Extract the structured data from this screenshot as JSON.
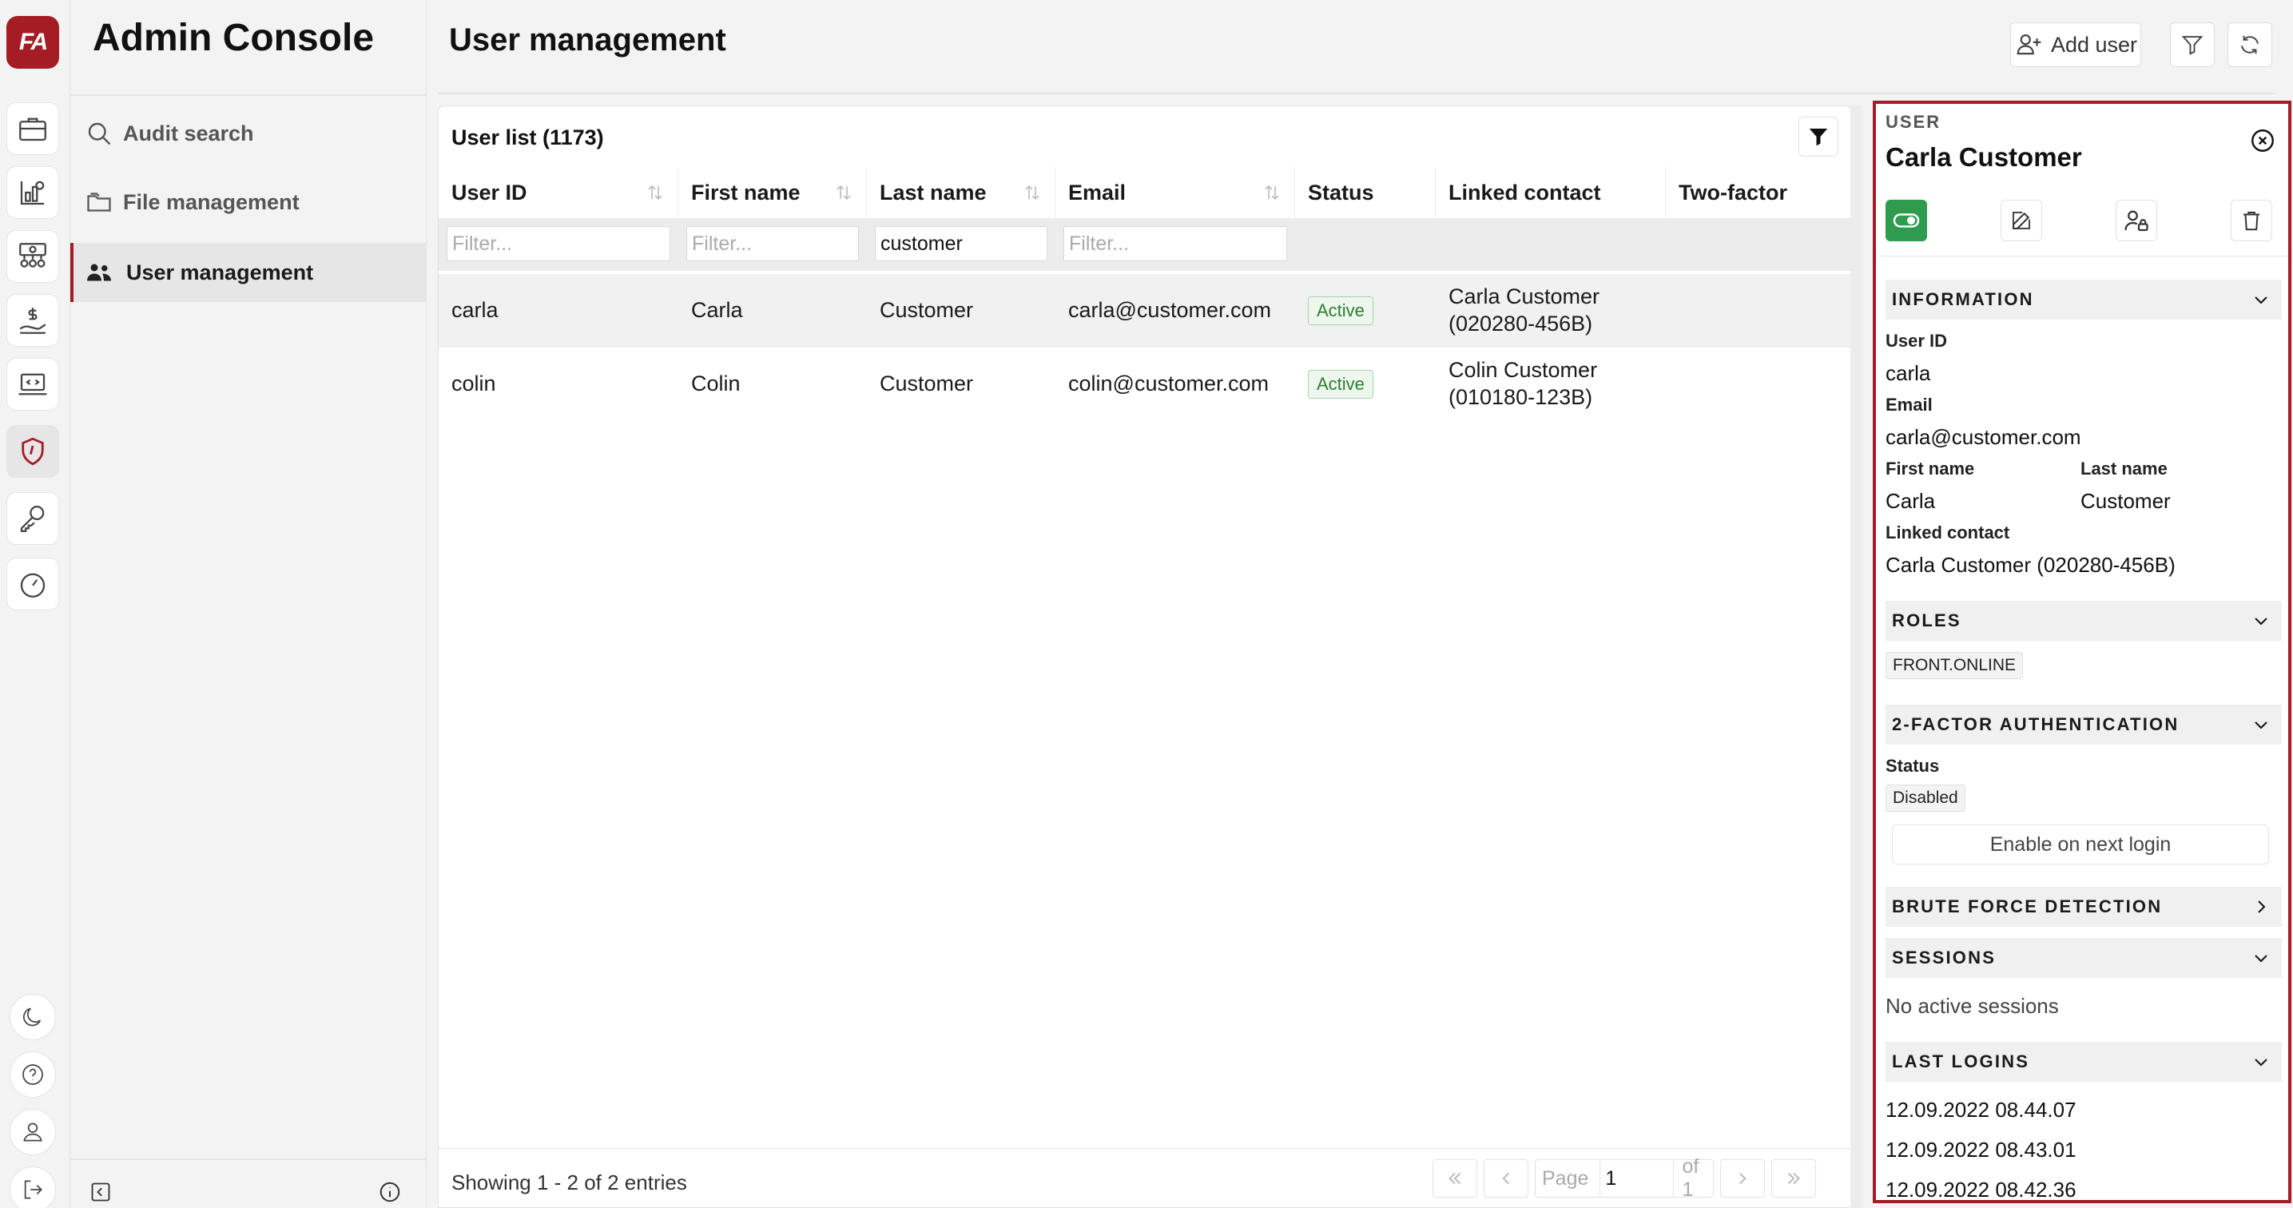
{
  "app": {
    "logo_text": "FA",
    "title": "Admin Console"
  },
  "rail": {
    "icons": [
      "portfolio-icon",
      "reports-icon",
      "organization-icon",
      "finance-icon",
      "developer-icon",
      "shield-icon",
      "key-icon",
      "dashboard-gauge-icon"
    ],
    "bottom_icons": [
      "moon-icon",
      "help-icon",
      "profile-icon",
      "logout-icon"
    ],
    "active": "shield-icon"
  },
  "subnav": {
    "items": [
      {
        "label": "Audit search",
        "icon": "search-icon"
      },
      {
        "label": "File management",
        "icon": "folder-icon"
      },
      {
        "label": "User management",
        "icon": "users-icon",
        "active": true
      }
    ]
  },
  "header": {
    "title": "User management",
    "add_user_label": "Add user"
  },
  "table": {
    "title": "User list (1173)",
    "columns": [
      "User ID",
      "First name",
      "Last name",
      "Email",
      "Status",
      "Linked contact",
      "Two-factor"
    ],
    "filters": {
      "placeholder": "Filter...",
      "user_id": "",
      "first_name": "",
      "last_name": "customer",
      "email": ""
    },
    "rows": [
      {
        "user_id": "carla",
        "first_name": "Carla",
        "last_name": "Customer",
        "email": "carla@customer.com",
        "status": "Active",
        "contact_line1": "Carla Customer",
        "contact_line2": "(020280-456B)",
        "two_factor": ""
      },
      {
        "user_id": "colin",
        "first_name": "Colin",
        "last_name": "Customer",
        "email": "colin@customer.com",
        "status": "Active",
        "contact_line1": "Colin Customer",
        "contact_line2": "(010180-123B)",
        "two_factor": ""
      }
    ],
    "footer": {
      "showing": "Showing 1 - 2 of 2 entries",
      "page_label": "Page",
      "page_value": "1",
      "of_label": "of 1"
    }
  },
  "detail": {
    "label": "USER",
    "name": "Carla Customer",
    "sections": {
      "information": "INFORMATION",
      "roles": "ROLES",
      "two_factor": "2-FACTOR AUTHENTICATION",
      "brute_force": "BRUTE FORCE DETECTION",
      "sessions": "SESSIONS",
      "last_logins": "LAST LOGINS"
    },
    "info": {
      "user_id_label": "User ID",
      "user_id": "carla",
      "email_label": "Email",
      "email": "carla@customer.com",
      "first_name_label": "First name",
      "first_name": "Carla",
      "last_name_label": "Last name",
      "last_name": "Customer",
      "linked_contact_label": "Linked contact",
      "linked_contact": "Carla Customer (020280-456B)"
    },
    "roles": [
      "FRONT.ONLINE"
    ],
    "two_factor": {
      "status_label": "Status",
      "status": "Disabled",
      "enable_label": "Enable on next login"
    },
    "sessions": {
      "empty": "No active sessions"
    },
    "last_logins": [
      "12.09.2022 08.44.07",
      "12.09.2022 08.43.01",
      "12.09.2022 08.42.36"
    ]
  },
  "colors": {
    "brand": "#a51c24",
    "active_green": "#2e9b4e",
    "badge_green": "#2e7d32"
  }
}
